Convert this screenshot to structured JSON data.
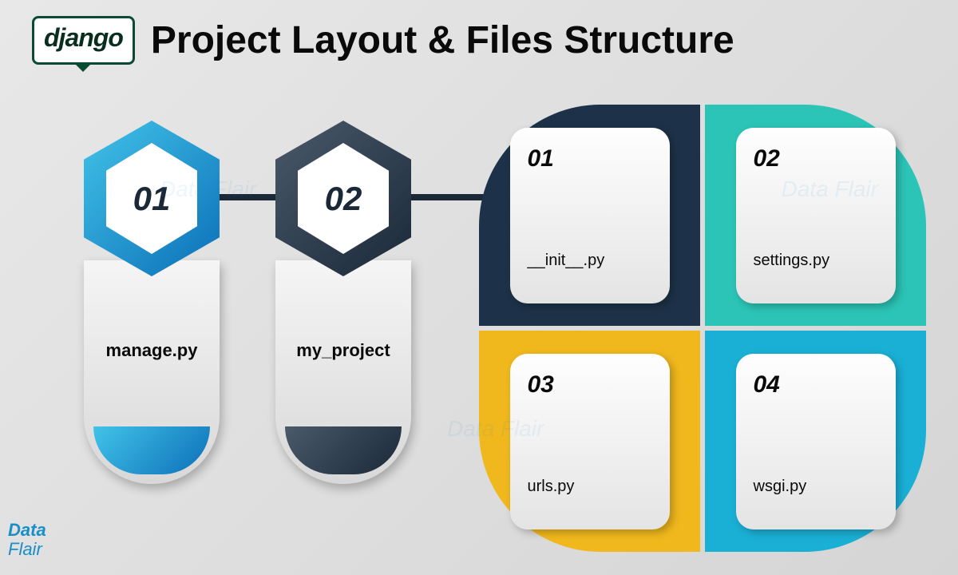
{
  "header": {
    "logo_text": "django",
    "title": "Project Layout & Files Structure"
  },
  "hexes": [
    {
      "number": "01",
      "label": "manage.py",
      "theme": "blue"
    },
    {
      "number": "02",
      "label": "my_project",
      "theme": "dark"
    }
  ],
  "quad": [
    {
      "number": "01",
      "label": "__init__.py",
      "pos": "tl"
    },
    {
      "number": "02",
      "label": "settings.py",
      "pos": "tr"
    },
    {
      "number": "03",
      "label": "urls.py",
      "pos": "bl"
    },
    {
      "number": "04",
      "label": "wsgi.py",
      "pos": "br"
    }
  ],
  "branding": {
    "line1": "Data",
    "line2": "Flair"
  },
  "watermark": "Data Flair"
}
